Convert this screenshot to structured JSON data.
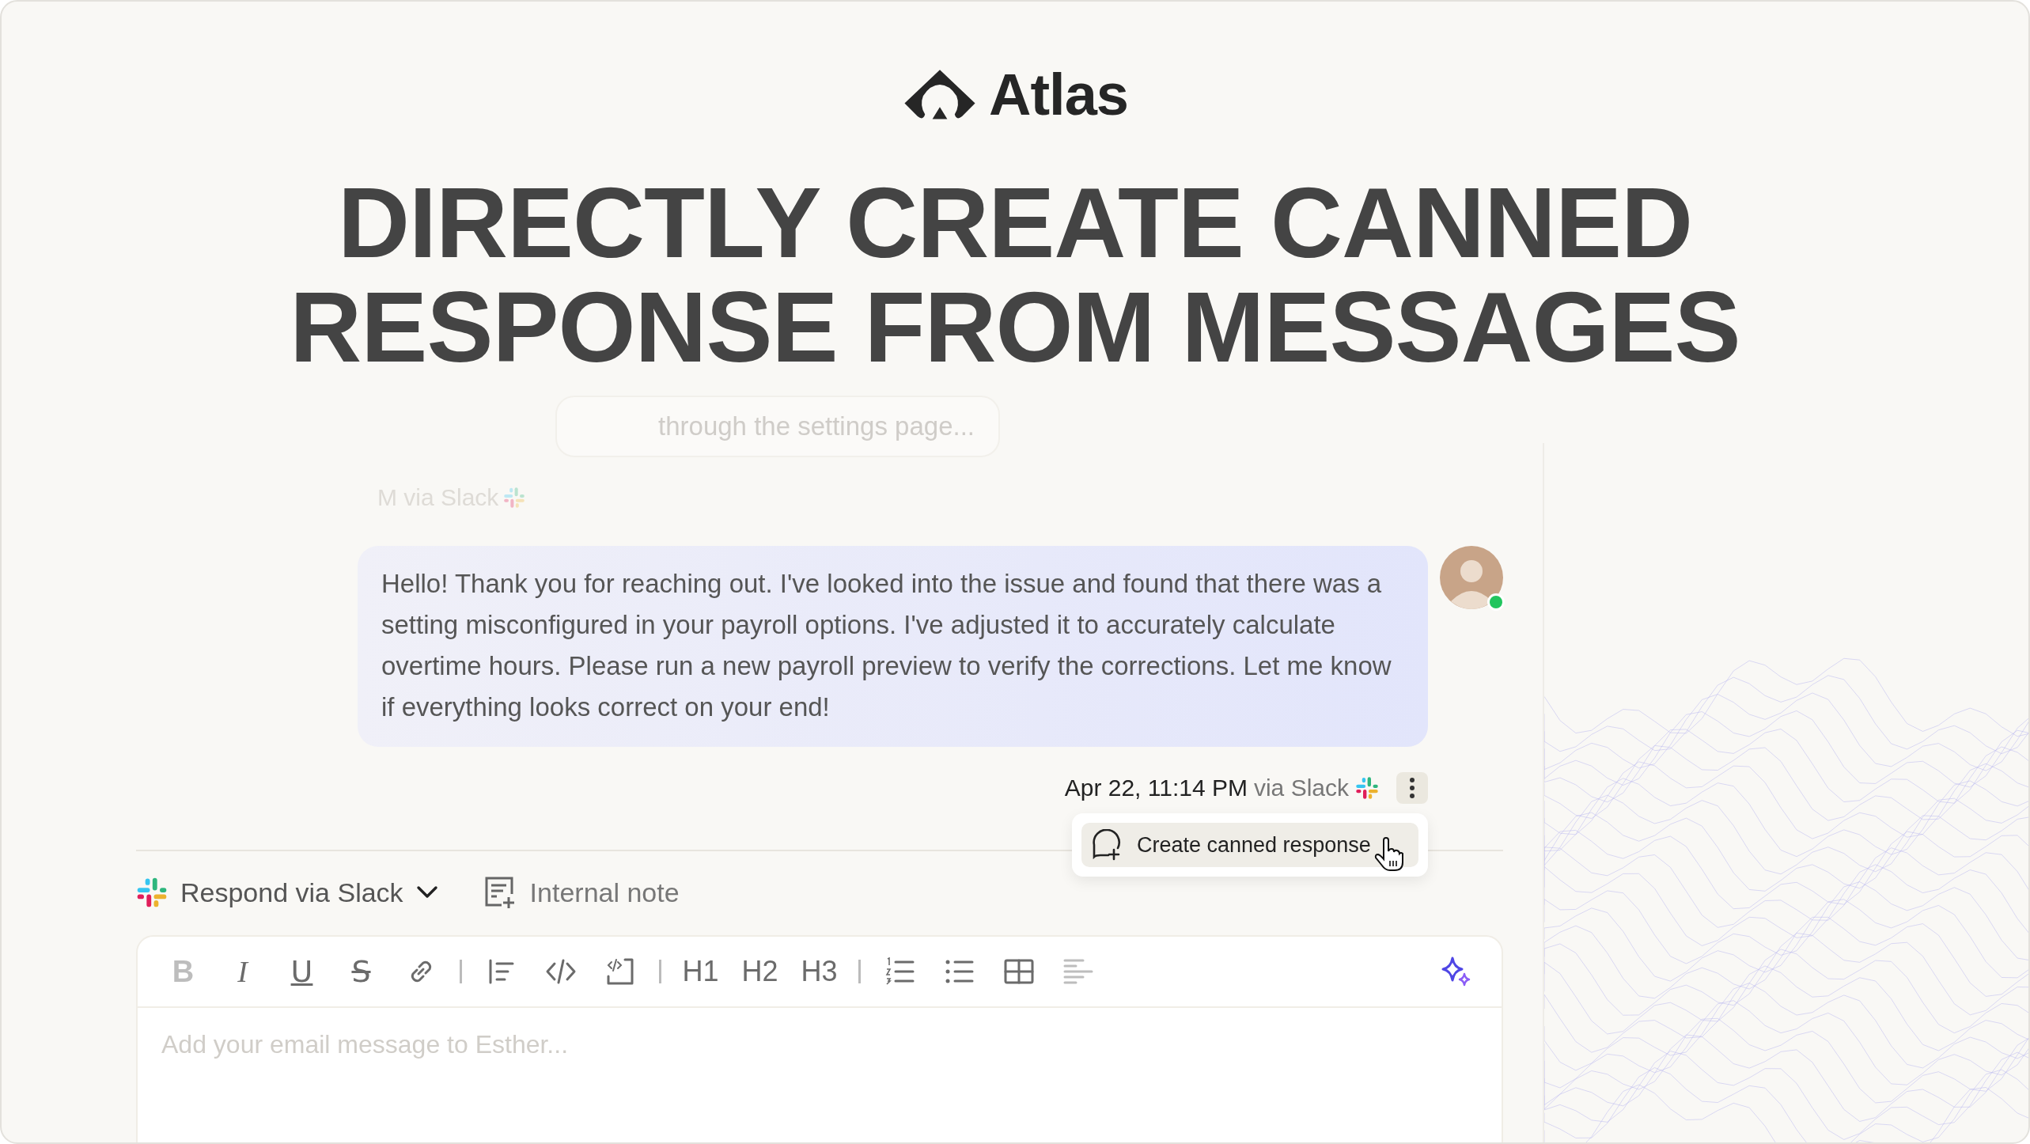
{
  "brand": {
    "name": "Atlas"
  },
  "headline": [
    "DIRECTLY CREATE CANNED",
    "RESPONSE FROM MESSAGES"
  ],
  "conversation": {
    "faded_message": {
      "text": "through the settings page..."
    },
    "faded_meta": {
      "text": "M via Slack"
    },
    "message": {
      "text": "Hello! Thank you for reaching out. I've looked into the issue and found that there was a setting misconfigured in your payroll options. I've adjusted it to accurately calculate overtime hours. Please run a new payroll preview to verify the corrections. Let me know if everything looks correct on your end!",
      "online": true
    },
    "meta": {
      "time": "Apr 22, 11:14 PM",
      "channel": "via Slack"
    },
    "menu": {
      "open": true,
      "items": [
        {
          "label": "Create canned response",
          "hovered": true
        }
      ]
    }
  },
  "composer": {
    "modes": [
      {
        "label": "Respond via Slack",
        "kind": "channel",
        "selected": true
      },
      {
        "label": "Internal note",
        "kind": "note",
        "selected": false
      }
    ],
    "toolbar": [
      {
        "kind": "bold",
        "label": "B",
        "disabled": true
      },
      {
        "kind": "italic",
        "label": "I",
        "disabled": false
      },
      {
        "kind": "underline",
        "label": "U",
        "disabled": false
      },
      {
        "kind": "strike",
        "label": "S",
        "disabled": false
      },
      {
        "kind": "link",
        "disabled": false
      },
      {
        "kind": "divider"
      },
      {
        "kind": "quote",
        "disabled": false
      },
      {
        "kind": "code",
        "disabled": false
      },
      {
        "kind": "codeblock",
        "disabled": false
      },
      {
        "kind": "divider"
      },
      {
        "kind": "heading",
        "label": "H1",
        "disabled": false
      },
      {
        "kind": "heading",
        "label": "H2",
        "disabled": false
      },
      {
        "kind": "heading",
        "label": "H3",
        "disabled": false
      },
      {
        "kind": "divider"
      },
      {
        "kind": "ordered-list",
        "disabled": false
      },
      {
        "kind": "bullet-list",
        "disabled": false
      },
      {
        "kind": "table",
        "disabled": false
      },
      {
        "kind": "align",
        "disabled": true
      }
    ],
    "placeholder": "Add your email message to Esther..."
  }
}
